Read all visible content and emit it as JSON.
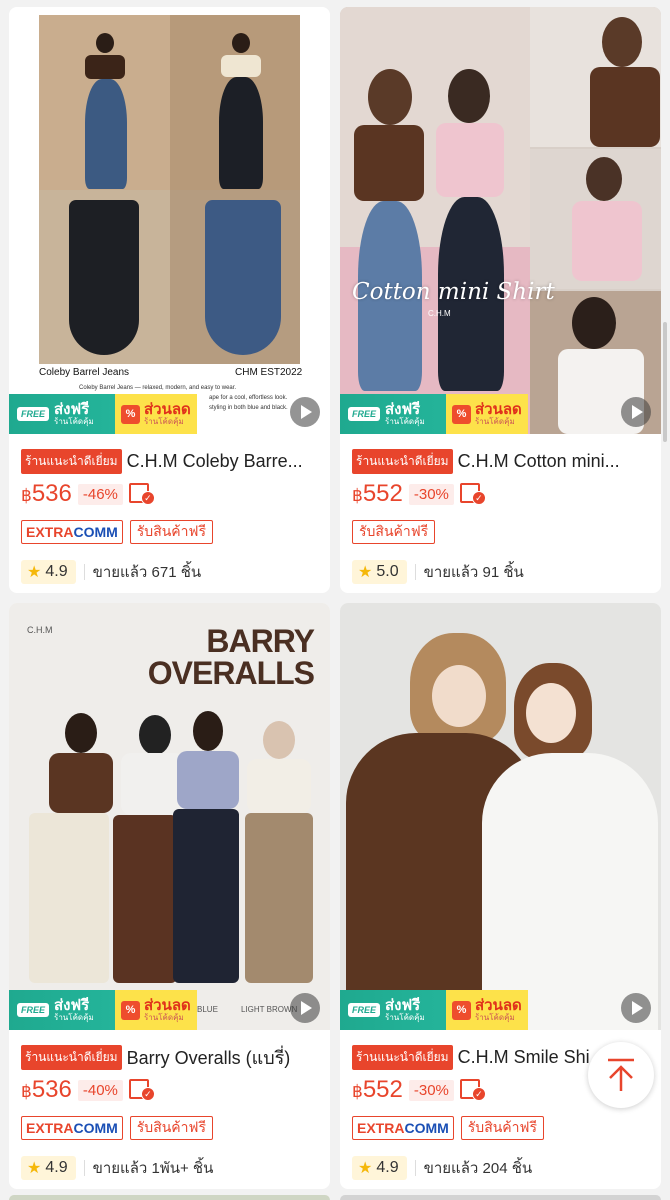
{
  "products": [
    {
      "rec_tag": "ร้านแนะนำดีเยี่ยม",
      "title": "C.H.M Coleby Barre...",
      "currency": "฿",
      "price": "536",
      "discount": "-46%",
      "tag_extra_a": "EXTRA",
      "tag_extra_b": "COMM",
      "free_tag": "รับสินค้าฟรี",
      "rating": "4.9",
      "sold": "ขายแล้ว 671 ชิ้น",
      "image": {
        "caption_left": "Coleby Barrel Jeans",
        "caption_right": "CHM EST2022",
        "desc_1": "Coleby Barrel Jeans — relaxed, modern, and easy to wear.",
        "desc_2": "ape for a cool, effortless look.",
        "desc_3": "styling in both blue and black."
      },
      "has_extra": true
    },
    {
      "rec_tag": "ร้านแนะนำดีเยี่ยม",
      "title": "C.H.M Cotton mini...",
      "currency": "฿",
      "price": "552",
      "discount": "-30%",
      "free_tag": "รับสินค้าฟรี",
      "rating": "5.0",
      "sold": "ขายแล้ว 91 ชิ้น",
      "image": {
        "script_title": "Cotton mini Shirt",
        "brand": "C.H.M"
      },
      "has_extra": false
    },
    {
      "rec_tag": "ร้านแนะนำดีเยี่ยม",
      "title": "Barry Overalls (แบรี่)",
      "currency": "฿",
      "price": "536",
      "discount": "-40%",
      "tag_extra_a": "EXTRA",
      "tag_extra_b": "COMM",
      "free_tag": "รับสินค้าฟรี",
      "rating": "4.9",
      "sold": "ขายแล้ว 1พัน+ ชิ้น",
      "image": {
        "brand": "C.H.M",
        "headline_1": "BARRY",
        "headline_2": "OVERALLS",
        "color_1": "BLUE",
        "color_2": "LIGHT BROWN"
      },
      "has_extra": true
    },
    {
      "rec_tag": "ร้านแนะนำดีเยี่ยม",
      "title": "C.H.M Smile Shi...",
      "currency": "฿",
      "price": "552",
      "discount": "-30%",
      "tag_extra_a": "EXTRA",
      "tag_extra_b": "COMM",
      "free_tag": "รับสินค้าฟรี",
      "rating": "4.9",
      "sold": "ขายแล้ว 204 ชิ้น",
      "image": {},
      "has_extra": true
    }
  ],
  "banner": {
    "free_badge": "FREE",
    "free_big": "ส่งฟรี",
    "free_small": "ร้านโค้ดคุ้ม",
    "disc_badge": "%",
    "disc_big": "ส่วนลด",
    "disc_small": "ร้านโค้ดคุ้ม"
  },
  "colors": {
    "accent": "#e8452c",
    "free_green": "#1fa98f",
    "discount_yellow": "#fde24a",
    "star": "#f5b80a"
  }
}
